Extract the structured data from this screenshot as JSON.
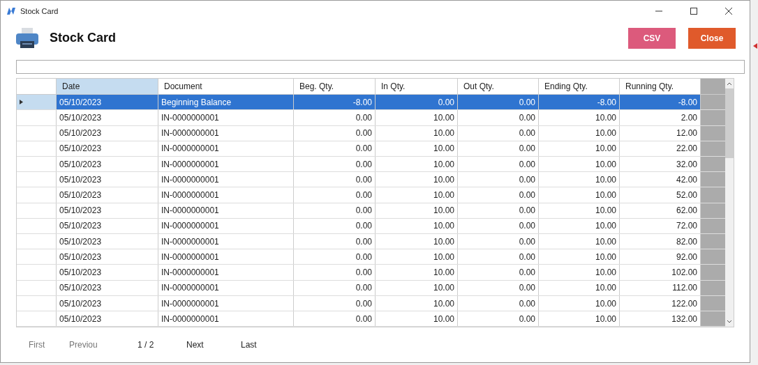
{
  "window": {
    "title": "Stock Card"
  },
  "header": {
    "title": "Stock Card"
  },
  "buttons": [
    {
      "label": "CSV",
      "kind": "csv"
    },
    {
      "label": "Close",
      "kind": "close"
    }
  ],
  "table": {
    "columns": [
      {
        "label": "Date",
        "selected": true
      },
      {
        "label": "Document",
        "selected": false
      },
      {
        "label": "Beg. Qty.",
        "selected": false
      },
      {
        "label": "In Qty.",
        "selected": false
      },
      {
        "label": "Out Qty.",
        "selected": false
      },
      {
        "label": "Ending Qty.",
        "selected": false
      },
      {
        "label": "Running Qty.",
        "selected": false
      }
    ],
    "rows": [
      {
        "selected": true,
        "cells": [
          "05/10/2023",
          "Beginning Balance",
          "-8.00",
          "0.00",
          "0.00",
          "-8.00",
          "-8.00"
        ]
      },
      {
        "selected": false,
        "cells": [
          "05/10/2023",
          "IN-0000000001",
          "0.00",
          "10.00",
          "0.00",
          "10.00",
          "2.00"
        ]
      },
      {
        "selected": false,
        "cells": [
          "05/10/2023",
          "IN-0000000001",
          "0.00",
          "10.00",
          "0.00",
          "10.00",
          "12.00"
        ]
      },
      {
        "selected": false,
        "cells": [
          "05/10/2023",
          "IN-0000000001",
          "0.00",
          "10.00",
          "0.00",
          "10.00",
          "22.00"
        ]
      },
      {
        "selected": false,
        "cells": [
          "05/10/2023",
          "IN-0000000001",
          "0.00",
          "10.00",
          "0.00",
          "10.00",
          "32.00"
        ]
      },
      {
        "selected": false,
        "cells": [
          "05/10/2023",
          "IN-0000000001",
          "0.00",
          "10.00",
          "0.00",
          "10.00",
          "42.00"
        ]
      },
      {
        "selected": false,
        "cells": [
          "05/10/2023",
          "IN-0000000001",
          "0.00",
          "10.00",
          "0.00",
          "10.00",
          "52.00"
        ]
      },
      {
        "selected": false,
        "cells": [
          "05/10/2023",
          "IN-0000000001",
          "0.00",
          "10.00",
          "0.00",
          "10.00",
          "62.00"
        ]
      },
      {
        "selected": false,
        "cells": [
          "05/10/2023",
          "IN-0000000001",
          "0.00",
          "10.00",
          "0.00",
          "10.00",
          "72.00"
        ]
      },
      {
        "selected": false,
        "cells": [
          "05/10/2023",
          "IN-0000000001",
          "0.00",
          "10.00",
          "0.00",
          "10.00",
          "82.00"
        ]
      },
      {
        "selected": false,
        "cells": [
          "05/10/2023",
          "IN-0000000001",
          "0.00",
          "10.00",
          "0.00",
          "10.00",
          "92.00"
        ]
      },
      {
        "selected": false,
        "cells": [
          "05/10/2023",
          "IN-0000000001",
          "0.00",
          "10.00",
          "0.00",
          "10.00",
          "102.00"
        ]
      },
      {
        "selected": false,
        "cells": [
          "05/10/2023",
          "IN-0000000001",
          "0.00",
          "10.00",
          "0.00",
          "10.00",
          "112.00"
        ]
      },
      {
        "selected": false,
        "cells": [
          "05/10/2023",
          "IN-0000000001",
          "0.00",
          "10.00",
          "0.00",
          "10.00",
          "122.00"
        ]
      },
      {
        "selected": false,
        "cells": [
          "05/10/2023",
          "IN-0000000001",
          "0.00",
          "10.00",
          "0.00",
          "10.00",
          "132.00"
        ]
      }
    ]
  },
  "pager": [
    {
      "label": "First",
      "kind": "link"
    },
    {
      "label": "Previou",
      "kind": "link"
    },
    {
      "label": "1 / 2",
      "kind": "status"
    },
    {
      "label": "Next",
      "kind": "link"
    },
    {
      "label": "Last",
      "kind": "link"
    }
  ]
}
